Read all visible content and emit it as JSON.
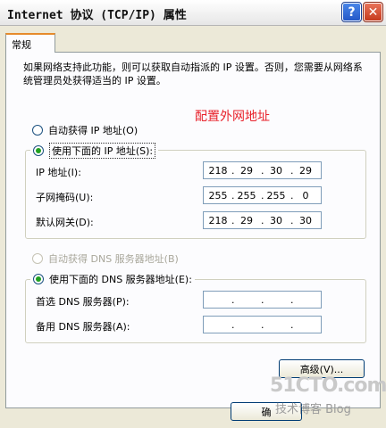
{
  "window": {
    "title": "Internet 协议 (TCP/IP) 属性"
  },
  "titlebar_buttons": {
    "help": "?",
    "close": "✕"
  },
  "tab": {
    "label": "常规"
  },
  "description": "如果网络支持此功能，则可以获取自动指派的 IP 设置。否则，您需要从网络系统管理员处获得适当的 IP 设置。",
  "annotation": "配置外网地址",
  "ip_section": {
    "auto_option": "自动获得 IP 地址(O)",
    "manual_option": "使用下面的 IP 地址(S):",
    "selected": "manual",
    "ip_label": "IP 地址(I):",
    "ip_value": [
      "218",
      "29",
      "30",
      "29"
    ],
    "mask_label": "子网掩码(U):",
    "mask_value": [
      "255",
      "255",
      "255",
      "0"
    ],
    "gateway_label": "默认网关(D):",
    "gateway_value": [
      "218",
      "29",
      "30",
      "30"
    ]
  },
  "dns_section": {
    "auto_option": "自动获得 DNS 服务器地址(B)",
    "manual_option": "使用下面的 DNS 服务器地址(E):",
    "selected": "manual",
    "preferred_label": "首选 DNS 服务器(P):",
    "preferred_value": [
      "",
      "",
      "",
      ""
    ],
    "alternate_label": "备用 DNS 服务器(A):",
    "alternate_value": [
      "",
      "",
      "",
      ""
    ]
  },
  "buttons": {
    "advanced": "高级(V)...",
    "ok": "确"
  },
  "watermark": {
    "main": "51CTO.com",
    "sub": "技术博客 Blog"
  }
}
